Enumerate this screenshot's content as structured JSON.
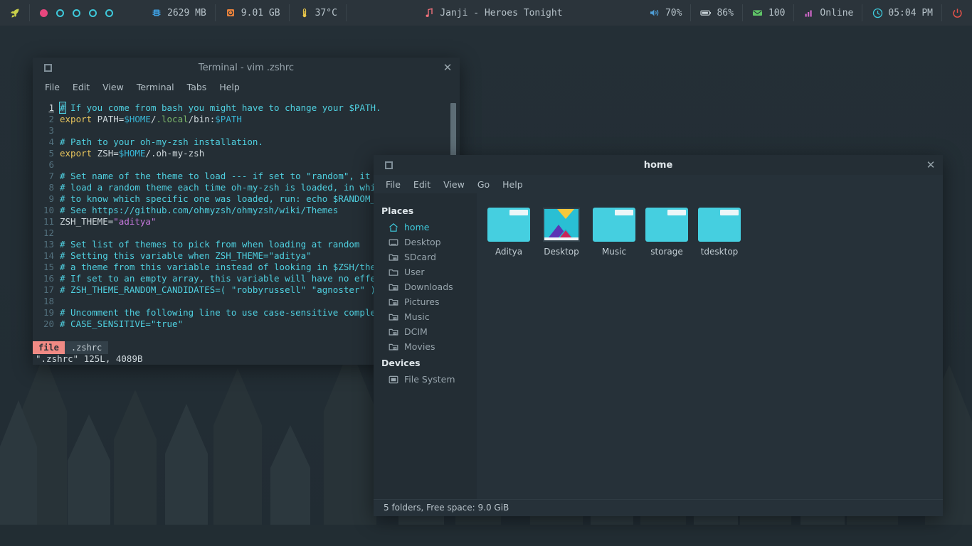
{
  "topbar": {
    "launcher_icon": "rocket-icon",
    "workspaces": [
      {
        "name": "workspace-1",
        "state": "active"
      },
      {
        "name": "workspace-2",
        "state": "idle"
      },
      {
        "name": "workspace-3",
        "state": "idle"
      },
      {
        "name": "workspace-4",
        "state": "idle"
      },
      {
        "name": "workspace-5",
        "state": "idle"
      }
    ],
    "memory": {
      "icon": "memory-chip-icon",
      "value": "2629 MB"
    },
    "disk": {
      "icon": "hard-drive-icon",
      "value": "9.01 GB"
    },
    "temperature": {
      "icon": "thermometer-icon",
      "value": "37°C"
    },
    "now_playing": {
      "icon": "music-note-icon",
      "value": "Janji - Heroes Tonight"
    },
    "volume": {
      "icon": "speaker-icon",
      "value": "70%"
    },
    "battery": {
      "icon": "battery-icon",
      "value": "86%"
    },
    "mail": {
      "icon": "envelope-icon",
      "value": "100"
    },
    "network": {
      "icon": "signal-bars-icon",
      "value": "Online"
    },
    "clock": {
      "icon": "clock-icon",
      "value": "05:04 PM"
    },
    "power": {
      "icon": "power-icon"
    },
    "colors": {
      "bar_bg": "#2b343b",
      "text": "#b6c2c9",
      "workspace_active": "#e8477e",
      "workspace_idle": "#3ec9db",
      "memory": "#3f9fe0",
      "disk": "#e8823c",
      "temp": "#e8c54a",
      "music": "#f0707a",
      "volume": "#4f9fd8",
      "battery": "#c9d3d8",
      "mail": "#5fc466",
      "network": "#d066c9",
      "clock": "#3ec9db",
      "power": "#e3524a"
    }
  },
  "terminal": {
    "title": "Terminal - vim .zshrc",
    "maximize_icon": "maximize-icon",
    "close_icon": "close-icon",
    "menu": [
      "File",
      "Edit",
      "View",
      "Terminal",
      "Tabs",
      "Help"
    ],
    "lines": [
      {
        "n": "1",
        "cursor": "#",
        "segs": [
          {
            "t": " If you come from bash you might have to change your $PATH.",
            "c": "cmt"
          }
        ]
      },
      {
        "n": "2",
        "segs": [
          {
            "t": "export",
            "c": "kw"
          },
          {
            "t": " PATH=",
            "c": "plain"
          },
          {
            "t": "$HOME",
            "c": "var"
          },
          {
            "t": "/",
            "c": "plain"
          },
          {
            "t": ".local",
            "c": "grn"
          },
          {
            "t": "/bin:",
            "c": "plain"
          },
          {
            "t": "$PATH",
            "c": "var"
          }
        ]
      },
      {
        "n": "3",
        "segs": []
      },
      {
        "n": "4",
        "segs": [
          {
            "t": "# Path to your oh-my-zsh installation.",
            "c": "cmt"
          }
        ]
      },
      {
        "n": "5",
        "segs": [
          {
            "t": "export",
            "c": "kw"
          },
          {
            "t": " ZSH=",
            "c": "plain"
          },
          {
            "t": "$HOME",
            "c": "var"
          },
          {
            "t": "/.oh-my-zsh",
            "c": "plain"
          }
        ]
      },
      {
        "n": "6",
        "segs": []
      },
      {
        "n": "7",
        "segs": [
          {
            "t": "# Set name of the theme to load --- if set to \"random\", it will",
            "c": "cmt"
          }
        ]
      },
      {
        "n": "8",
        "segs": [
          {
            "t": "# load a random theme each time oh-my-zsh is loaded, in which case,",
            "c": "cmt"
          }
        ]
      },
      {
        "n": "9",
        "segs": [
          {
            "t": "# to know which specific one was loaded, run: echo $RANDOM_THEME",
            "c": "cmt"
          }
        ]
      },
      {
        "n": "10",
        "segs": [
          {
            "t": "# See https://github.com/ohmyzsh/ohmyzsh/wiki/Themes",
            "c": "cmt"
          }
        ]
      },
      {
        "n": "11",
        "segs": [
          {
            "t": "ZSH_THEME=",
            "c": "plain"
          },
          {
            "t": "\"aditya\"",
            "c": "mag"
          }
        ]
      },
      {
        "n": "12",
        "segs": []
      },
      {
        "n": "13",
        "segs": [
          {
            "t": "# Set list of themes to pick from when loading at random",
            "c": "cmt"
          }
        ]
      },
      {
        "n": "14",
        "segs": [
          {
            "t": "# Setting this variable when ZSH_THEME=\"aditya\"",
            "c": "cmt"
          }
        ]
      },
      {
        "n": "15",
        "segs": [
          {
            "t": "# a theme from this variable instead of looking in $ZSH/themes/",
            "c": "cmt"
          }
        ]
      },
      {
        "n": "16",
        "segs": [
          {
            "t": "# If set to an empty array, this variable will have no effect.",
            "c": "cmt"
          }
        ]
      },
      {
        "n": "17",
        "segs": [
          {
            "t": "# ZSH_THEME_RANDOM_CANDIDATES=( \"robbyrussell\" \"agnoster\" )",
            "c": "cmt"
          }
        ]
      },
      {
        "n": "18",
        "segs": []
      },
      {
        "n": "19",
        "segs": [
          {
            "t": "# Uncomment the following line to use case-sensitive completion.",
            "c": "cmt"
          }
        ]
      },
      {
        "n": "20",
        "segs": [
          {
            "t": "# CASE_SENSITIVE=\"true\"",
            "c": "cmt"
          }
        ]
      }
    ],
    "status": {
      "mode": "file",
      "filename": ".zshrc",
      "position": "1"
    },
    "cmdline": "\".zshrc\" 125L, 4089B"
  },
  "filemanager": {
    "title": "home",
    "maximize_icon": "maximize-icon",
    "close_icon": "close-icon",
    "menu": [
      "File",
      "Edit",
      "View",
      "Go",
      "Help"
    ],
    "sidebar": {
      "places_label": "Places",
      "places": [
        {
          "label": "home",
          "icon": "home-icon",
          "selected": true
        },
        {
          "label": "Desktop",
          "icon": "desktop-icon",
          "selected": false
        },
        {
          "label": "SDcard",
          "icon": "folder-picture-icon",
          "selected": false
        },
        {
          "label": "User",
          "icon": "folder-icon",
          "selected": false
        },
        {
          "label": "Downloads",
          "icon": "folder-picture-icon",
          "selected": false
        },
        {
          "label": "Pictures",
          "icon": "folder-picture-icon",
          "selected": false
        },
        {
          "label": "Music",
          "icon": "folder-picture-icon",
          "selected": false
        },
        {
          "label": "DCIM",
          "icon": "folder-picture-icon",
          "selected": false
        },
        {
          "label": "Movies",
          "icon": "folder-picture-icon",
          "selected": false
        }
      ],
      "devices_label": "Devices",
      "devices": [
        {
          "label": "File System",
          "icon": "drive-icon"
        }
      ]
    },
    "files": [
      {
        "label": "Aditya",
        "icon": "folder-icon"
      },
      {
        "label": "Desktop",
        "icon": "image-thumbnail-icon"
      },
      {
        "label": "Music",
        "icon": "folder-icon"
      },
      {
        "label": "storage",
        "icon": "folder-icon"
      },
      {
        "label": "tdesktop",
        "icon": "folder-icon"
      }
    ],
    "status": "5 folders, Free space: 9.0 GiB",
    "colors": {
      "folder": "#45cfe0",
      "accent": "#3ec9db",
      "bg": "#263139",
      "sidebar_bg": "#232d34"
    }
  }
}
